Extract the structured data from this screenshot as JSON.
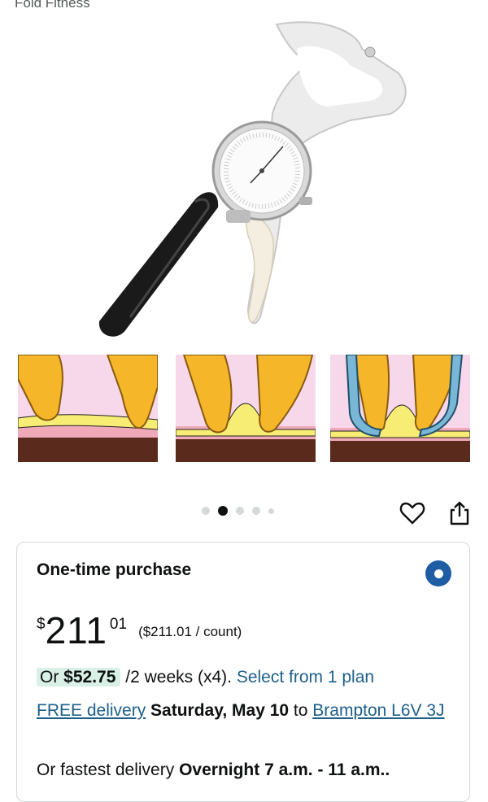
{
  "brand": "Fold Fitness",
  "gallery": {
    "dots": 5,
    "active_index": 1
  },
  "icons": {
    "favorite": "heart-icon",
    "share": "share-icon"
  },
  "purchase": {
    "title": "One-time purchase",
    "price_currency": "$",
    "price_whole": "211",
    "price_fraction": "01",
    "unit_price": "($211.01 / count)",
    "installment_prefix": "Or",
    "installment_amount": "$52.75",
    "installment_terms": "/2 weeks (x4).",
    "installment_link": "Select from 1 plan",
    "delivery_label": "FREE delivery",
    "delivery_date": "Saturday, May 10",
    "delivery_to": "to",
    "delivery_location": "Brampton L6V 3J",
    "fastest_prefix": "Or fastest delivery",
    "fastest_detail": "Overnight 7 a.m. - 11 a.m.."
  },
  "colors": {
    "link": "#1d5f8a",
    "radio": "#1e5ca3",
    "installment_bg": "#d8f0e6"
  }
}
